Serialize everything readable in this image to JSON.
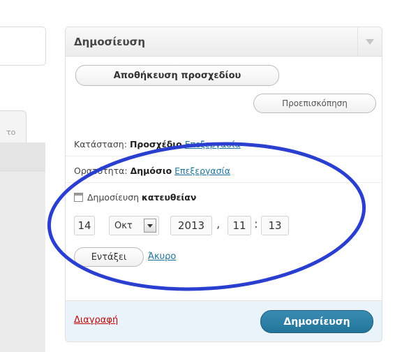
{
  "editor": {
    "tab_label": "το"
  },
  "publish_box": {
    "title": "Δημοσίευση",
    "save_draft_label": "Αποθήκευση προσχεδίου",
    "preview_label": "Προεπισκόπηση",
    "status": {
      "label": "Κατάσταση:",
      "value": "Προσχέδιο",
      "edit_link": "Επεξεργασία"
    },
    "visibility": {
      "label": "Ορατότητα:",
      "value": "Δημόσιο",
      "edit_link": "Επεξεργασία"
    },
    "schedule": {
      "label": "Δημοσίευση",
      "value": "κατευθείαν",
      "icon": "calendar-icon"
    },
    "date": {
      "day": "14",
      "month": "Οκτ",
      "year": "2013",
      "comma": ",",
      "hour": "11",
      "colon": ":",
      "minute": "13"
    },
    "ok_label": "Εντάξει",
    "cancel_label": "Άκυρο",
    "delete_label": "Διαγραφή",
    "publish_label": "Δημοσίευση"
  },
  "colors": {
    "link": "#21759b",
    "delete": "#bc0b0b",
    "publish_button": "#21759b",
    "footer_bg": "#eaf2fa",
    "annotation": "#2a3fd0"
  }
}
